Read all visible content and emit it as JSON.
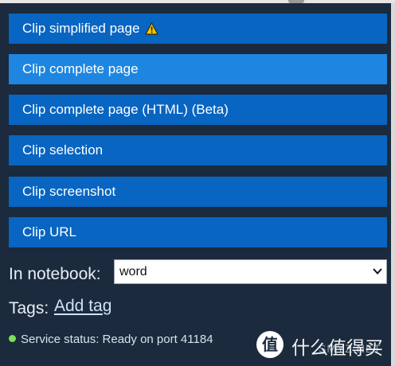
{
  "buttons": [
    {
      "label": "Clip simplified page",
      "warning": true
    },
    {
      "label": "Clip complete page",
      "active": true
    },
    {
      "label": "Clip complete page (HTML) (Beta)"
    },
    {
      "label": "Clip selection"
    },
    {
      "label": "Clip screenshot"
    },
    {
      "label": "Clip URL"
    }
  ],
  "notebook": {
    "label": "In notebook:",
    "selected": "word"
  },
  "tags": {
    "label": "Tags:",
    "add_label": "Add tag"
  },
  "status": {
    "text": "Service status: Ready on port 41184"
  },
  "watermark": {
    "logo_glyph": "值",
    "text": "什么值得买",
    "sub": "SMYZ.NET"
  },
  "colors": {
    "background": "#1b2a3c",
    "button": "#0865c1",
    "button_active": "#1e86e0",
    "status_ok": "#7dde5b",
    "warning": "#f5c800"
  }
}
